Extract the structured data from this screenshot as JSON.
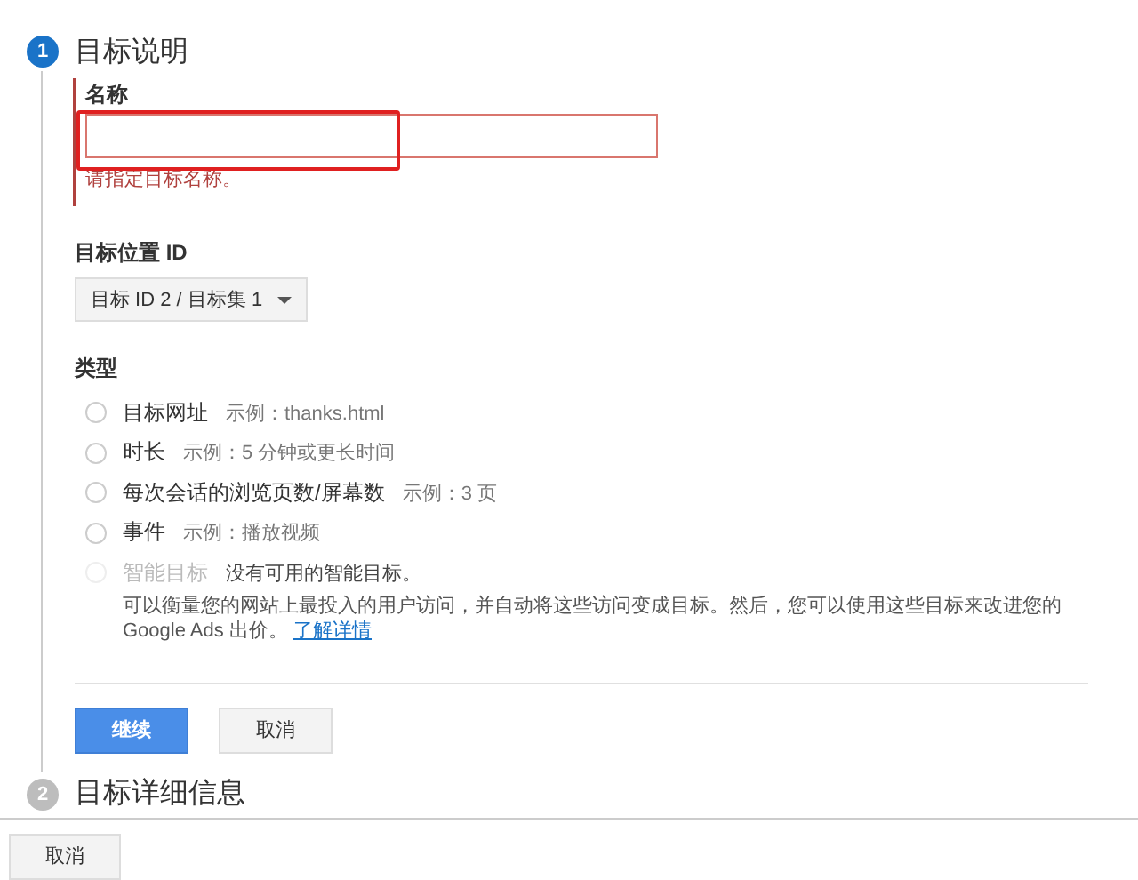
{
  "steps": [
    {
      "number": "1",
      "title": "目标说明",
      "active": true
    },
    {
      "number": "2",
      "title": "目标详细信息",
      "active": false
    }
  ],
  "name_field": {
    "label": "名称",
    "error": "请指定目标名称。",
    "invalid": true
  },
  "goal_slot": {
    "label": "目标位置 ID",
    "value": "目标 ID 2 / 目标集 1"
  },
  "type": {
    "label": "类型",
    "options": [
      {
        "label": "目标网址",
        "example": "示例：thanks.html",
        "selected": false,
        "disabled": false
      },
      {
        "label": "时长",
        "example": "示例：5 分钟或更长时间",
        "selected": false,
        "disabled": false
      },
      {
        "label": "每次会话的浏览页数/屏幕数",
        "example": "示例：3 页",
        "selected": false,
        "disabled": false
      },
      {
        "label": "事件",
        "example": "示例：播放视频",
        "selected": false,
        "disabled": false
      },
      {
        "label": "智能目标",
        "example": "没有可用的智能目标。",
        "selected": false,
        "disabled": true
      }
    ],
    "description": "可以衡量您的网站上最投入的用户访问，并自动将这些访问变成目标。然后，您可以使用这些目标来改进您的 Google Ads 出价。",
    "link": "了解详情"
  },
  "buttons": {
    "continue": "继续",
    "cancel": "取消"
  },
  "footer_cancel": "取消"
}
